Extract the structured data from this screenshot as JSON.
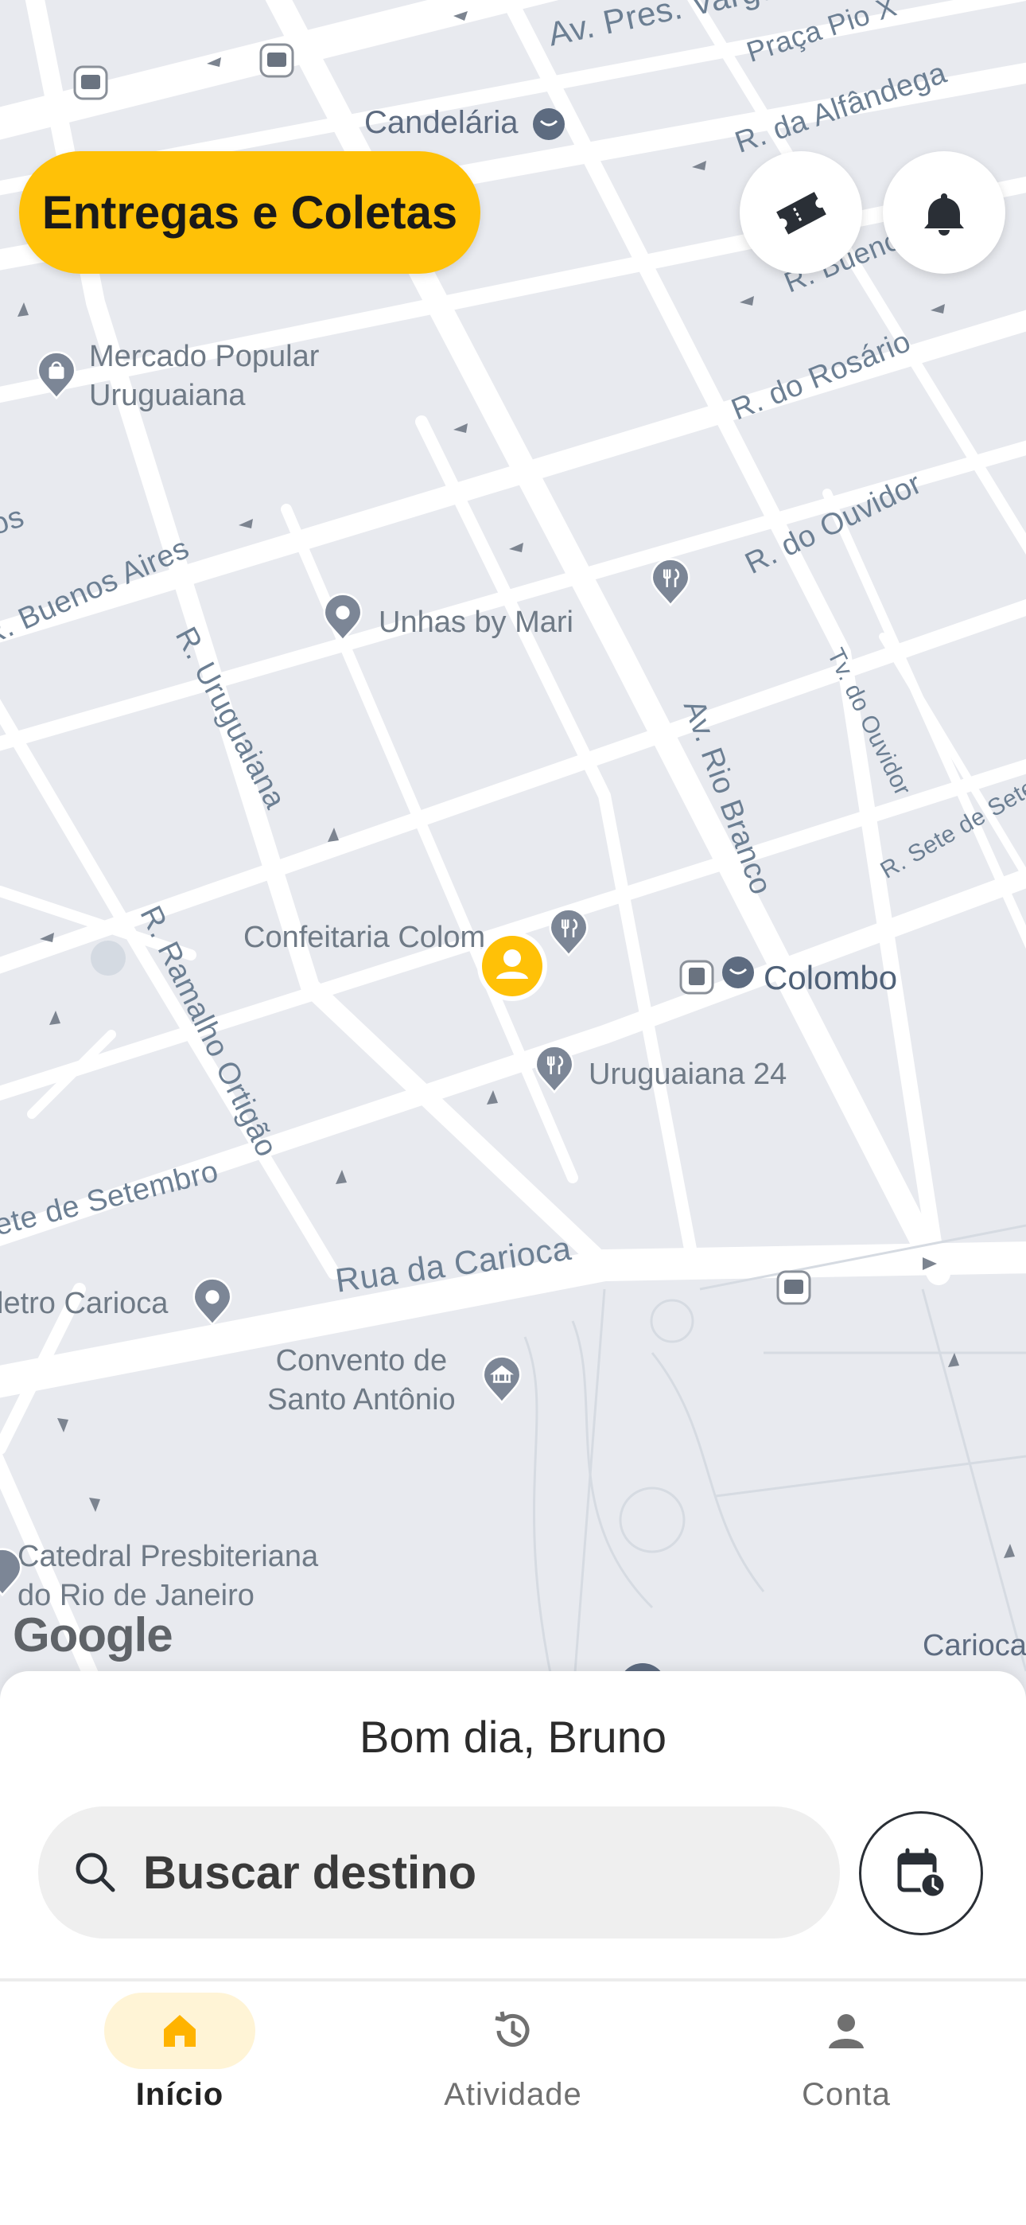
{
  "map": {
    "streets": [
      "Av. Pres. Vargas",
      "Praça Pio X",
      "R. da Alfândega",
      "R. Buenos",
      "R. do Rosário",
      "R. do Ouvidor",
      "R. Buenos Aires",
      "R. Uruguaiana",
      "Av. Rio Branco",
      "Tv. do Ouvidor",
      "R. Sete de Sete",
      "R. Ramalho Ortigão",
      "ete de Setembro",
      "Rua da Carioca",
      "os"
    ],
    "places": {
      "candelaria": "Candelária",
      "mercado": "Mercado Popular\nUruguaiana",
      "unhas": "Unhas by Mari",
      "confeitaria": "Confeitaria Colom",
      "colombo": "Colombo",
      "uruguaiana24": "Uruguaiana 24",
      "metro": "letro Carioca",
      "convento": "Convento de\nSanto Antônio",
      "catedral": "Catedral Presbiteriana\ndo Rio de Janeiro",
      "carioca": "Carioca"
    },
    "attribution": "Google"
  },
  "top": {
    "service_button": "Entregas e Coletas",
    "ticket_icon": "ticket-icon",
    "bell_icon": "bell-icon"
  },
  "sheet": {
    "greeting": "Bom dia, Bruno",
    "search_placeholder": "Buscar destino"
  },
  "nav": {
    "items": [
      {
        "label": "Início",
        "icon": "home-icon",
        "active": true
      },
      {
        "label": "Atividade",
        "icon": "history-icon",
        "active": false
      },
      {
        "label": "Conta",
        "icon": "person-icon",
        "active": false
      }
    ]
  },
  "colors": {
    "accent": "#ffc107",
    "map_bg": "#e8eaef",
    "road": "#ffffff",
    "pin": "#7c8696"
  }
}
